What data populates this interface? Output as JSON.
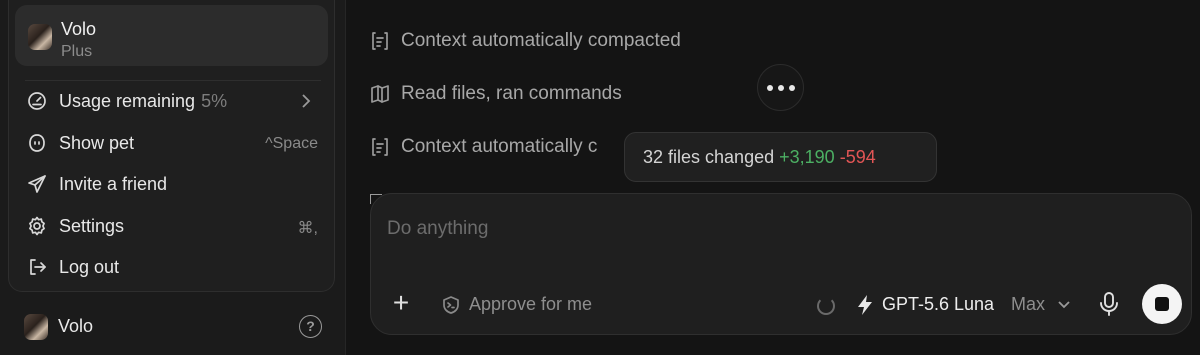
{
  "sidebar": {
    "account": {
      "name": "Volo",
      "plan": "Plus"
    },
    "menu": [
      {
        "id": "usage",
        "label": "Usage remaining",
        "value": "5%",
        "icon": "gauge-icon"
      },
      {
        "id": "pet",
        "label": "Show pet",
        "shortcut": "^Space",
        "icon": "pet-icon"
      },
      {
        "id": "invite",
        "label": "Invite a friend",
        "icon": "send-icon"
      },
      {
        "id": "settings",
        "label": "Settings",
        "shortcut": "⌘,",
        "icon": "gear-icon"
      },
      {
        "id": "logout",
        "label": "Log out",
        "icon": "logout-icon"
      }
    ],
    "footer": {
      "name": "Volo",
      "help": "?"
    }
  },
  "main": {
    "activity": [
      {
        "text": "Context automatically compacted",
        "icon": "compact-icon"
      },
      {
        "text": "Read files, ran commands",
        "icon": "book-icon"
      },
      {
        "text": "Context automatically c",
        "icon": "compact-icon"
      }
    ],
    "tooltip": {
      "text": "32 files changed",
      "additions": "+3,190",
      "deletions": "-594"
    },
    "composer": {
      "placeholder": "Do anything",
      "approve_label": "Approve for me",
      "model_name": "GPT-5.6 Luna",
      "model_tier": "Max",
      "plus": "+"
    }
  },
  "colors": {
    "additions": "#4caf63",
    "deletions": "#e25555",
    "background": "#141414"
  }
}
